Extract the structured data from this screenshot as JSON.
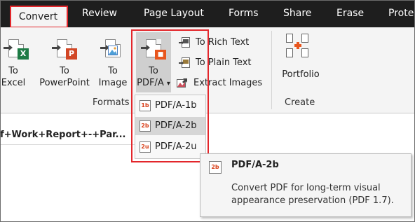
{
  "tabs": [
    {
      "label": "Convert",
      "active": true
    },
    {
      "label": "Review"
    },
    {
      "label": "Page Layout"
    },
    {
      "label": "Forms"
    },
    {
      "label": "Share"
    },
    {
      "label": "Erase"
    },
    {
      "label": "Prote"
    }
  ],
  "ribbon": {
    "to_excel": {
      "line1": "To",
      "line2": "Excel",
      "icon": "excel-icon",
      "badge": "X",
      "color": "#1e7b45"
    },
    "to_powerpoint": {
      "line1": "To",
      "line2": "PowerPoint",
      "icon": "powerpoint-icon",
      "badge": "P",
      "color": "#d24726"
    },
    "to_image": {
      "line1": "To",
      "line2": "Image",
      "icon": "image-icon"
    },
    "to_pdfa": {
      "line1": "To",
      "line2": "PDF/A",
      "dropdown": "▾",
      "icon": "pdfa-icon",
      "color": "#e8561e"
    },
    "rich_text": "To Rich Text",
    "plain_text": "To Plain Text",
    "extract_images": "Extract Images",
    "formats_label": "Formats",
    "portfolio": "Portfolio",
    "create_label": "Create"
  },
  "document": {
    "tab_title": "f+Work+Report+-+Par..."
  },
  "menu": {
    "items": [
      {
        "label": "PDF/A-1b",
        "icon_text": "1b"
      },
      {
        "label": "PDF/A-2b",
        "icon_text": "2b",
        "hover": true
      },
      {
        "label": "PDF/A-2u",
        "icon_text": "2u"
      }
    ]
  },
  "tooltip": {
    "icon_text": "2b",
    "title": "PDF/A-2b",
    "body": "Convert PDF for long-term visual appearance preservation (PDF 1.7)."
  },
  "colors": {
    "highlight_border": "#e3262b",
    "tabbar_bg": "#1e1e1e"
  }
}
